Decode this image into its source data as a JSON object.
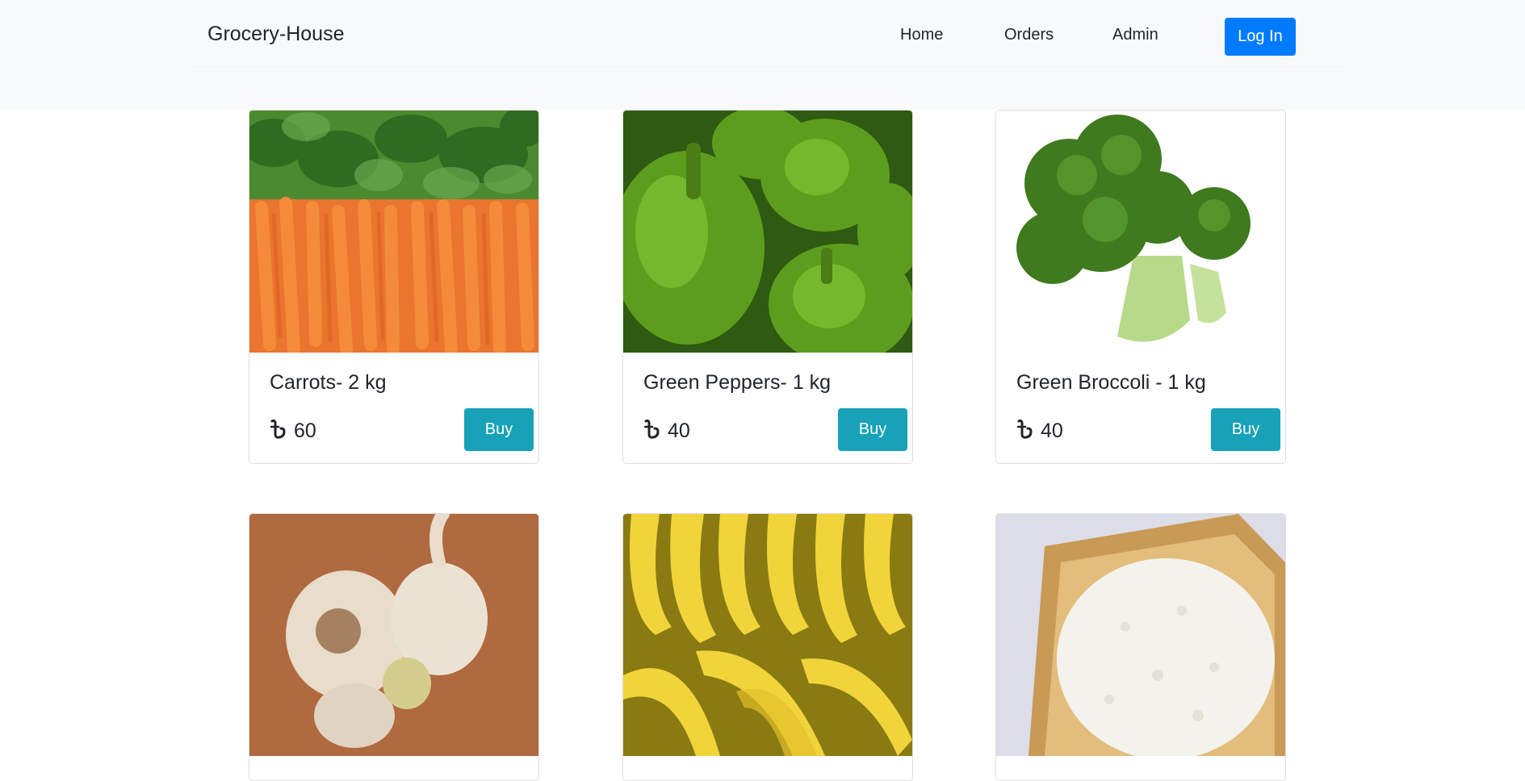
{
  "navbar": {
    "brand": "Grocery-House",
    "links": [
      "Home",
      "Orders",
      "Admin"
    ],
    "login_label": "Log In"
  },
  "products": [
    {
      "title": "Carrots- 2 kg",
      "price": "60",
      "buy_label": "Buy",
      "image": "carrots"
    },
    {
      "title": "Green Peppers- 1 kg",
      "price": "40",
      "buy_label": "Buy",
      "image": "green-peppers"
    },
    {
      "title": "Green Broccoli - 1 kg",
      "price": "40",
      "buy_label": "Buy",
      "image": "broccoli"
    },
    {
      "title": "",
      "price": "",
      "buy_label": "",
      "image": "garlic"
    },
    {
      "title": "",
      "price": "",
      "buy_label": "",
      "image": "bananas"
    },
    {
      "title": "",
      "price": "",
      "buy_label": "",
      "image": "rice"
    }
  ],
  "colors": {
    "navbar_bg": "#f8f9fa",
    "login_button": "#007bff",
    "buy_button": "#17a2b8"
  },
  "icons": {
    "currency": "taka-icon"
  }
}
